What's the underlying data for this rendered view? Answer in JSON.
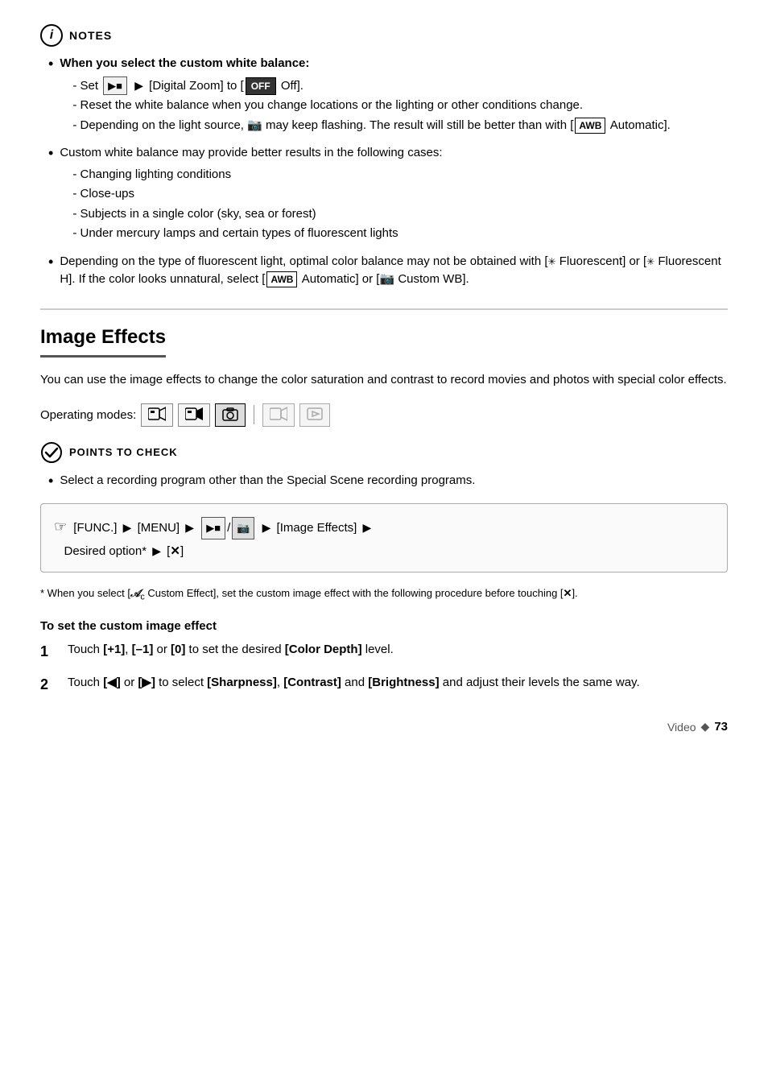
{
  "notes": {
    "header": "NOTES",
    "items": [
      {
        "text": "When you select the custom white balance:",
        "bold": true,
        "subitems": [
          "Set [Digital Zoom] to [OFF Off].",
          "Reset the white balance when you change locations or the lighting or other conditions change.",
          "Depending on the light source, [icon] may keep flashing. The result will still be better than with [AWB Automatic]."
        ]
      },
      {
        "text": "Custom white balance may provide better results in the following cases:",
        "subitems": [
          "Changing lighting conditions",
          "Close-ups",
          "Subjects in a single color (sky, sea or forest)",
          "Under mercury lamps and certain types of fluorescent lights"
        ]
      },
      {
        "text": "Depending on the type of fluorescent light, optimal color balance may not be obtained with [Fluorescent] or [Fluorescent H]. If the color looks unnatural, select [AWB Automatic] or [Custom WB]."
      }
    ]
  },
  "image_effects": {
    "section_title": "Image Effects",
    "description": "You can use the image effects to change the color saturation and contrast to record movies and photos with special color effects.",
    "operating_modes_label": "Operating modes:",
    "modes": [
      "🎥",
      "▶",
      "📷",
      "▶",
      "▶"
    ],
    "points_to_check": {
      "header": "POINTS TO CHECK",
      "items": [
        "Select a recording program other than the Special Scene recording programs."
      ]
    },
    "instruction_box": "[FUNC.] ▶ [MENU] ▶ [Movie]/[Photo] ▶ [Image Effects] ▶ Desired option* ▶ [✕]",
    "footnote": "* When you select [Custom Effect], set the custom image effect with the following procedure before touching [✕].",
    "custom_effect": {
      "header": "To set the custom image effect",
      "steps": [
        "Touch [+1], [–1] or [0] to set the desired [Color Depth] level.",
        "Touch [◀] or [▶] to select [Sharpness], [Contrast] and [Brightness] and adjust their levels the same way."
      ]
    }
  },
  "footer": {
    "label": "Video",
    "separator": "◆",
    "page_number": "73"
  }
}
